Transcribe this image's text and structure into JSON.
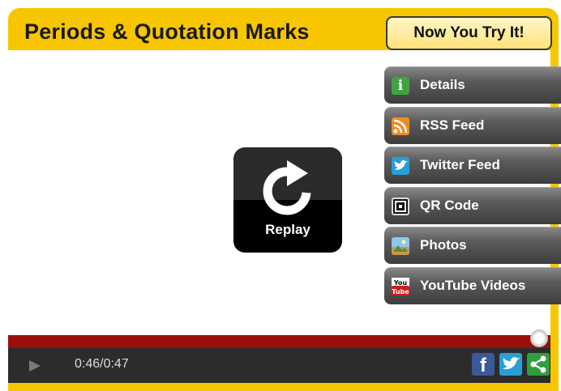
{
  "player": {
    "title": "Periods & Quotation Marks",
    "try_button": "Now You Try It!"
  },
  "replay": {
    "label": "Replay"
  },
  "menu": {
    "items": [
      {
        "label": "Details",
        "icon": "info-icon"
      },
      {
        "label": "RSS Feed",
        "icon": "rss-icon"
      },
      {
        "label": "Twitter Feed",
        "icon": "twitter-icon"
      },
      {
        "label": "QR Code",
        "icon": "qr-code-icon"
      },
      {
        "label": "Photos",
        "icon": "photos-icon"
      },
      {
        "label": "YouTube Videos",
        "icon": "youtube-icon"
      }
    ]
  },
  "controls": {
    "time": "0:46/0:47",
    "progress": 0.979,
    "share_icons": [
      "facebook-icon",
      "twitter-icon",
      "share-icon"
    ]
  },
  "colors": {
    "frame": "#f7c600",
    "progress": "#9d0f0c",
    "controls_bg": "#2c2c2c"
  }
}
